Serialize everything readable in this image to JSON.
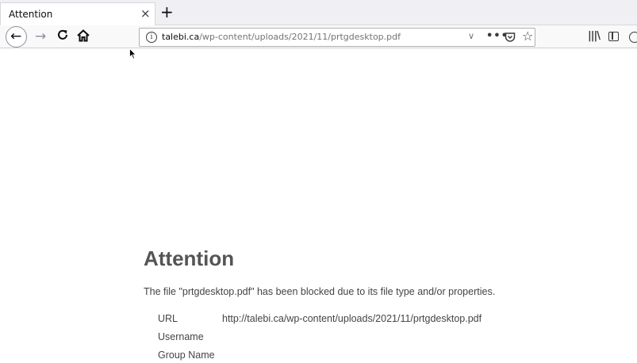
{
  "browser": {
    "tab": {
      "title": "Attention",
      "close_glyph": "×"
    },
    "new_tab_glyph": "+",
    "nav": {
      "back_glyph": "←",
      "forward_glyph": "→",
      "reload_glyph": "C",
      "icons": [
        "back-icon",
        "forward-icon",
        "reload-icon",
        "home-icon"
      ]
    },
    "urlbar": {
      "host": "talebi.ca",
      "path": "/wp-content/uploads/2021/11/prtgdesktop.pdf",
      "info_glyph": "i",
      "dropdown_glyph": "∨",
      "page_actions_glyph": "•••",
      "star_glyph": "☆"
    },
    "toolbar": {
      "library_glyph": "|||\\"
    }
  },
  "page": {
    "heading": "Attention",
    "message": "The file \"prtgdesktop.pdf\" has been blocked due to its file type and/or properties.",
    "details": [
      {
        "label": "URL",
        "value": "http://talebi.ca/wp-content/uploads/2021/11/prtgdesktop.pdf"
      },
      {
        "label": "Username",
        "value": ""
      },
      {
        "label": "Group Name",
        "value": ""
      }
    ]
  },
  "colors": {
    "tabstrip_bg": "#f0f0f4",
    "navbar_bg": "#f9f9fa",
    "heading_text": "#555555",
    "body_text": "#444444"
  }
}
